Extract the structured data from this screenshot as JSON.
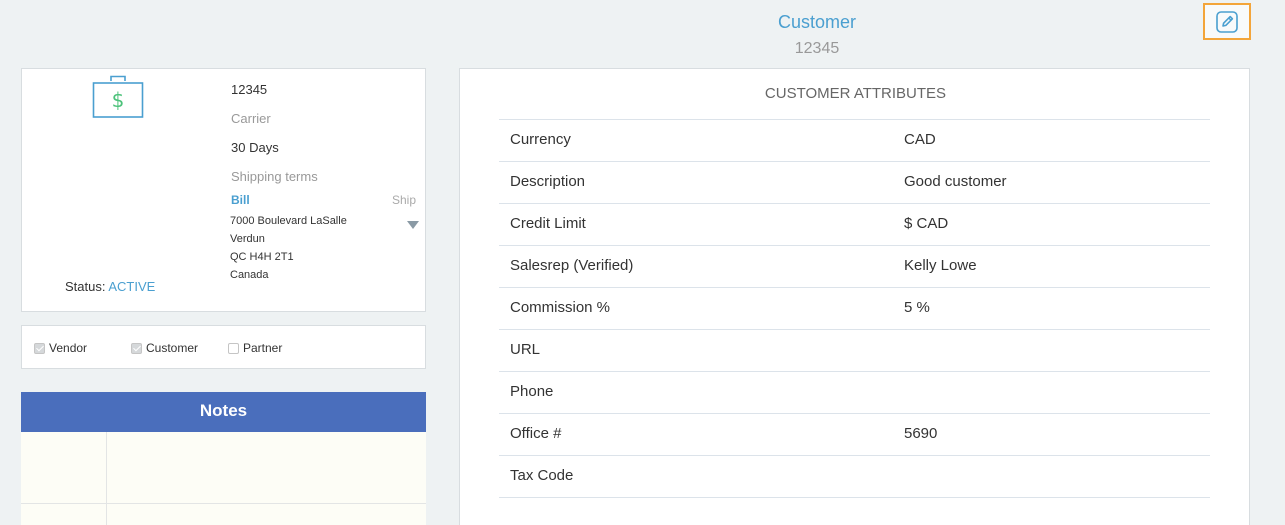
{
  "header": {
    "title": "Customer",
    "id": "12345"
  },
  "profile": {
    "fields": [
      {
        "value": "12345",
        "placeholder": ""
      },
      {
        "value": "",
        "placeholder": "Carrier"
      },
      {
        "value": "30 Days",
        "placeholder": ""
      },
      {
        "value": "",
        "placeholder": "Shipping terms"
      }
    ],
    "address_tabs": {
      "bill": "Bill",
      "ship": "Ship"
    },
    "address_lines": [
      "7000 Boulevard LaSalle",
      "Verdun",
      "QC H4H 2T1",
      "Canada"
    ],
    "status_label": "Status:",
    "status_value": "ACTIVE"
  },
  "flags": [
    {
      "label": "Vendor",
      "checked": true
    },
    {
      "label": "Customer",
      "checked": true
    },
    {
      "label": "Partner",
      "checked": false
    }
  ],
  "notes": {
    "title": "Notes"
  },
  "attributes": {
    "title": "CUSTOMER ATTRIBUTES",
    "rows": [
      {
        "key": "Currency",
        "value": "CAD"
      },
      {
        "key": "Description",
        "value": "Good customer"
      },
      {
        "key": "Credit Limit",
        "value": "$ CAD"
      },
      {
        "key": "Salesrep (Verified)",
        "value": "Kelly Lowe"
      },
      {
        "key": "Commission %",
        "value": "5 %"
      },
      {
        "key": "URL",
        "value": ""
      },
      {
        "key": "Phone",
        "value": ""
      },
      {
        "key": "Office #",
        "value": "5690"
      },
      {
        "key": "Tax Code",
        "value": ""
      }
    ]
  },
  "icons": {
    "edit": "edit-pencil-icon",
    "wallet": "money-briefcase-icon"
  },
  "colors": {
    "accent": "#4a9fd0",
    "notes_header": "#4a6ebc",
    "edit_border": "#f3a53a",
    "wallet_green": "#4cc27a"
  }
}
